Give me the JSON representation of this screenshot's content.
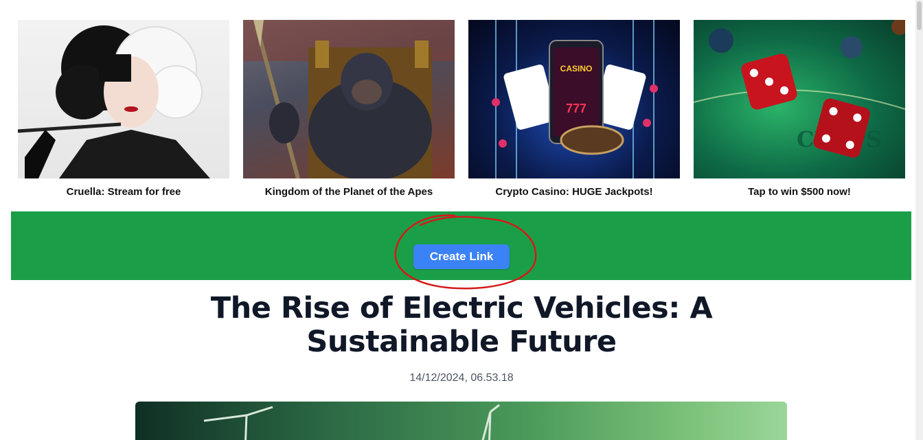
{
  "ads": [
    {
      "title": "Cruella: Stream for free",
      "image": "cruella-poster"
    },
    {
      "title": "Kingdom of the Planet of the Apes",
      "image": "ape-on-throne"
    },
    {
      "title": "Crypto Casino: HUGE Jackpots!",
      "image": "online-casino-phone"
    },
    {
      "title": "Tap to win $500 now!",
      "image": "red-dice-craps-table"
    }
  ],
  "banner": {
    "button_label": "Create Link",
    "color": "#1a9f48",
    "button_color": "#3b82f6"
  },
  "article": {
    "title": "The Rise of Electric Vehicles: A Sustainable Future",
    "date": "14/12/2024, 06.53.18",
    "hero_image": "wind-turbines-green"
  }
}
